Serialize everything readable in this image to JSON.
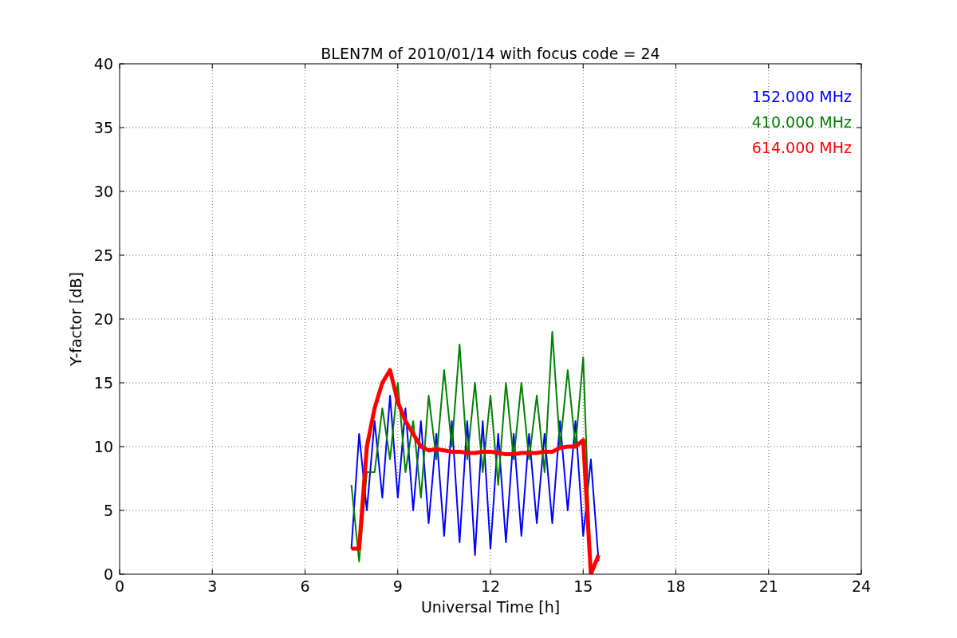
{
  "chart_data": {
    "type": "line",
    "title": "BLEN7M of 2010/01/14 with focus code = 24",
    "xlabel": "Universal Time [h]",
    "ylabel": "Y-factor [dB]",
    "x": [
      7.5,
      7.75,
      8,
      8.25,
      8.5,
      8.75,
      9,
      9.25,
      9.5,
      9.75,
      10,
      10.25,
      10.5,
      10.75,
      11,
      11.25,
      11.5,
      11.75,
      12,
      12.25,
      12.5,
      12.75,
      13,
      13.25,
      13.5,
      13.75,
      14,
      14.25,
      14.5,
      14.75,
      15,
      15.25,
      15.5
    ],
    "series": [
      {
        "name": "152.000 MHz",
        "color": "#0000ff",
        "values": [
          2,
          11,
          5,
          12,
          6,
          14,
          6,
          13,
          5,
          12,
          4,
          11,
          3,
          12,
          2.5,
          12,
          1.5,
          12,
          2,
          11,
          2.5,
          11,
          3,
          11,
          4,
          11,
          4,
          12,
          5,
          12,
          3,
          9,
          1
        ]
      },
      {
        "name": "410.000 MHz",
        "color": "#008000",
        "values": [
          7,
          1,
          8,
          8,
          13,
          9,
          15,
          8,
          12,
          6,
          14,
          9,
          16,
          10,
          18,
          9,
          15,
          8,
          14,
          7,
          15,
          9,
          15,
          9,
          14,
          8,
          19,
          10,
          16,
          10,
          17,
          0,
          null
        ]
      },
      {
        "name": "614.000 MHz",
        "color": "#ff0000",
        "values": [
          2,
          2,
          10,
          13,
          15,
          16,
          13.5,
          12,
          11,
          10,
          9.7,
          9.8,
          9.7,
          9.6,
          9.6,
          9.5,
          9.5,
          9.6,
          9.6,
          9.5,
          9.4,
          9.4,
          9.5,
          9.5,
          9.5,
          9.6,
          9.6,
          9.9,
          10,
          10,
          10.5,
          0,
          1.5
        ]
      }
    ],
    "grid": true,
    "xlim": [
      0,
      24
    ],
    "ylim": [
      0,
      40
    ],
    "xticks": [
      0,
      3,
      6,
      9,
      12,
      15,
      18,
      21,
      24
    ],
    "yticks": [
      0,
      5,
      10,
      15,
      20,
      25,
      30,
      35,
      40
    ]
  }
}
